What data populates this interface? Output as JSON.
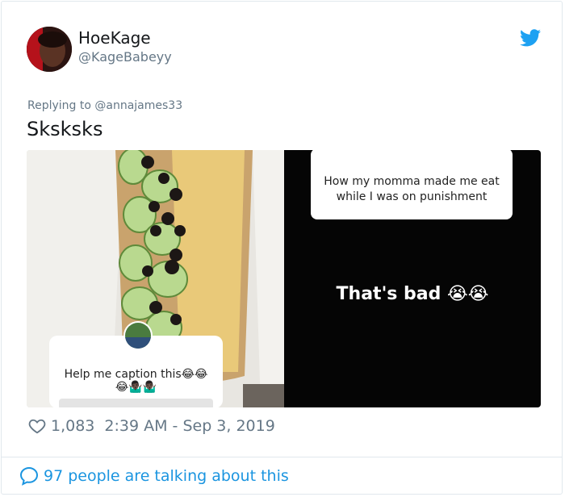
{
  "user": {
    "name": "HoeKage",
    "handle": "@KageBabeyy"
  },
  "reply": {
    "label": "Replying to",
    "to": "@annajames33"
  },
  "tweet": {
    "text": "Sksksks"
  },
  "media": {
    "left_caption": "Help me caption this😂😂",
    "left_caption_line2": "😂🤷🏿‍♂️🤷🏿‍♂️",
    "right_question": "How my momma made me eat while I was on punishment",
    "right_text": "That's bad 😭😭"
  },
  "meta": {
    "likes": "1,083",
    "time": "2:39 AM - Sep 3, 2019"
  },
  "footer": {
    "talking": "97 people are talking about this"
  },
  "colors": {
    "accent": "#1b95e0",
    "muted": "#657786",
    "border": "#e1e8ed"
  }
}
